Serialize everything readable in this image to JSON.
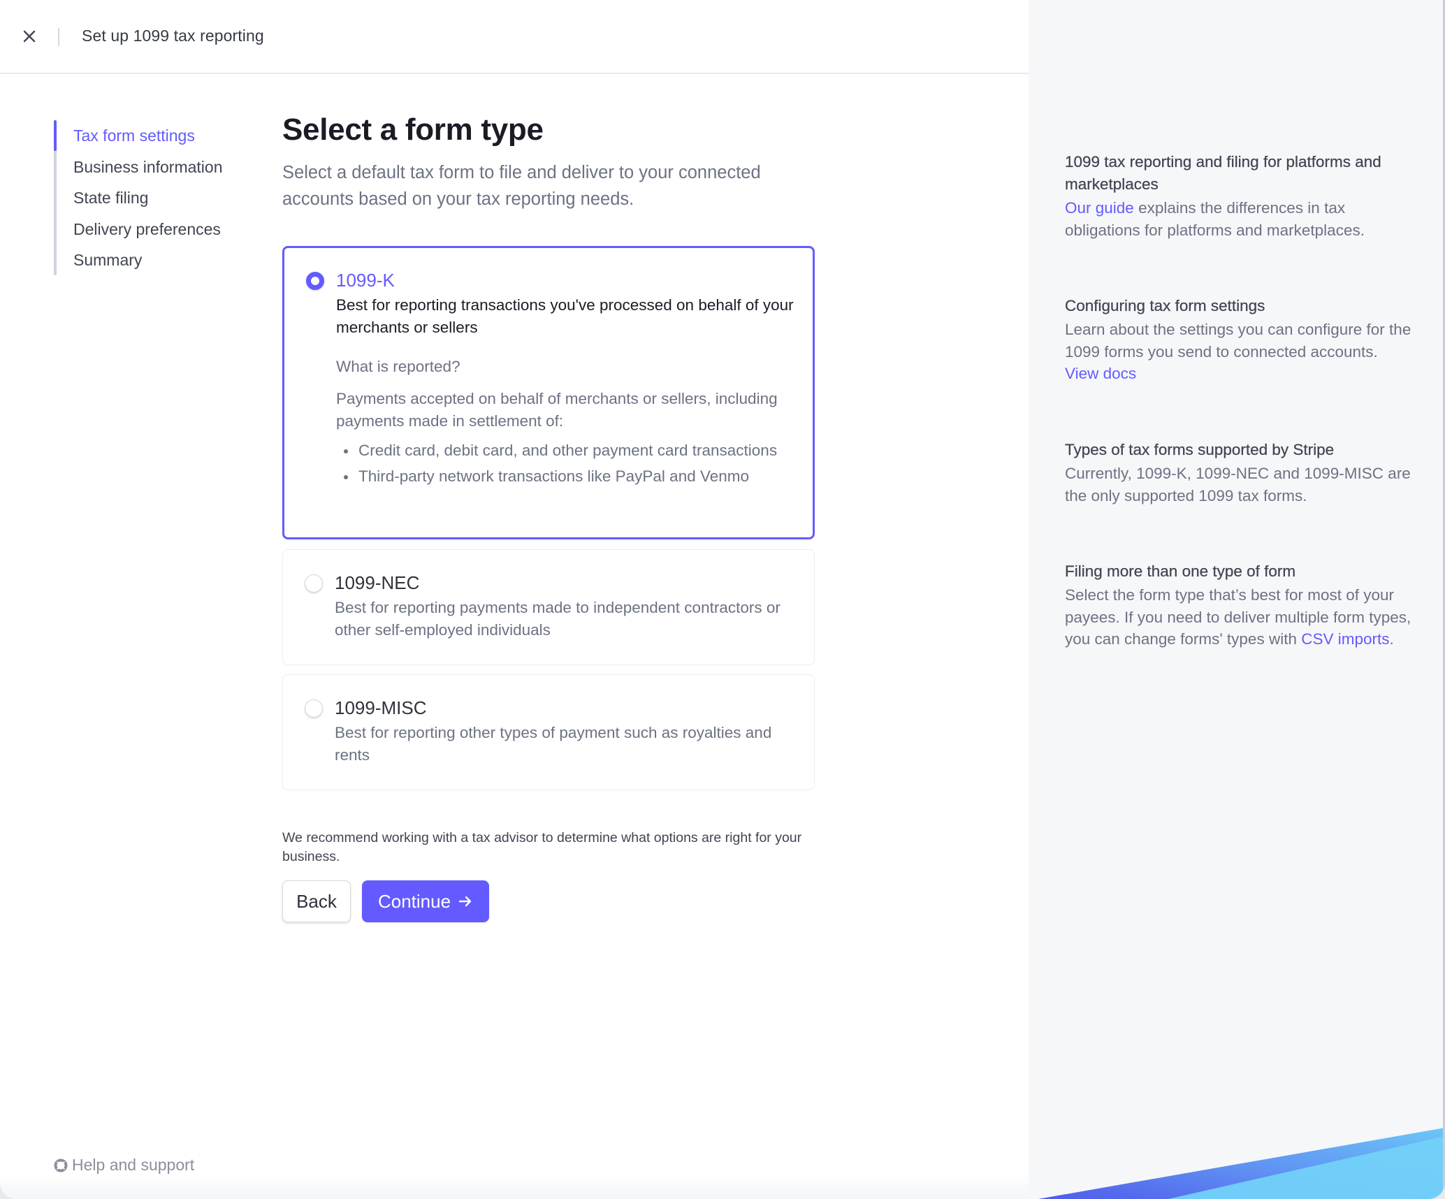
{
  "header": {
    "title": "Set up 1099 tax reporting",
    "close_icon": "close-icon"
  },
  "stepnav": {
    "active_index": 0,
    "items": [
      {
        "label": "Tax form settings"
      },
      {
        "label": "Business information"
      },
      {
        "label": "State filing"
      },
      {
        "label": "Delivery preferences"
      },
      {
        "label": "Summary"
      }
    ]
  },
  "main": {
    "title": "Select a form type",
    "subtitle": "Select a default tax form to file and deliver to your connected accounts based on your tax reporting needs.",
    "options": [
      {
        "title": "1099-K",
        "description": "Best for reporting transactions you've processed on behalf of your merchants or sellers",
        "selected": true,
        "subheading": "What is reported?",
        "body": "Payments accepted on behalf of merchants or sellers, including payments made in settlement of:",
        "bullets": [
          "Credit card, debit card, and other payment card transactions",
          "Third-party network transactions like PayPal and Venmo"
        ]
      },
      {
        "title": "1099-NEC",
        "description": "Best for reporting payments made to independent contractors or other self-employed individuals",
        "selected": false
      },
      {
        "title": "1099-MISC",
        "description": "Best for reporting other types of payment such as royalties and rents",
        "selected": false
      }
    ],
    "advisor_note": "We recommend working with a tax advisor to determine what options are right for your business.",
    "back_label": "Back",
    "continue_label": "Continue",
    "continue_icon": "arrow-right-icon"
  },
  "help": {
    "label": "Help and support",
    "icon": "lifebuoy-icon"
  },
  "aside": {
    "sections": [
      {
        "heading": "1099 tax reporting and filing for platforms and marketplaces",
        "link_before": "Our guide",
        "text": " explains the differences in tax obligations for platforms and marketplaces."
      },
      {
        "heading": "Configuring tax form settings",
        "text": "Learn about the settings you can configure for the 1099 forms you send to connected accounts. ",
        "link_after": "View docs"
      },
      {
        "heading": "Types of tax forms supported by Stripe",
        "text": "Currently, 1099-K, 1099-NEC and 1099-MISC are the only supported 1099 tax forms."
      },
      {
        "heading": "Filing more than one type of form",
        "text": "Select the form type that’s best for most of your payees. If you need to deliver multiple form types, you can change forms' types with ",
        "link_after": "CSV imports",
        "text_after": "."
      }
    ]
  },
  "colors": {
    "accent": "#635bff",
    "text_primary": "#1a1b25",
    "text_secondary": "#6c7283",
    "panel_bg": "#f6f7f9",
    "border": "#ebeef1"
  }
}
